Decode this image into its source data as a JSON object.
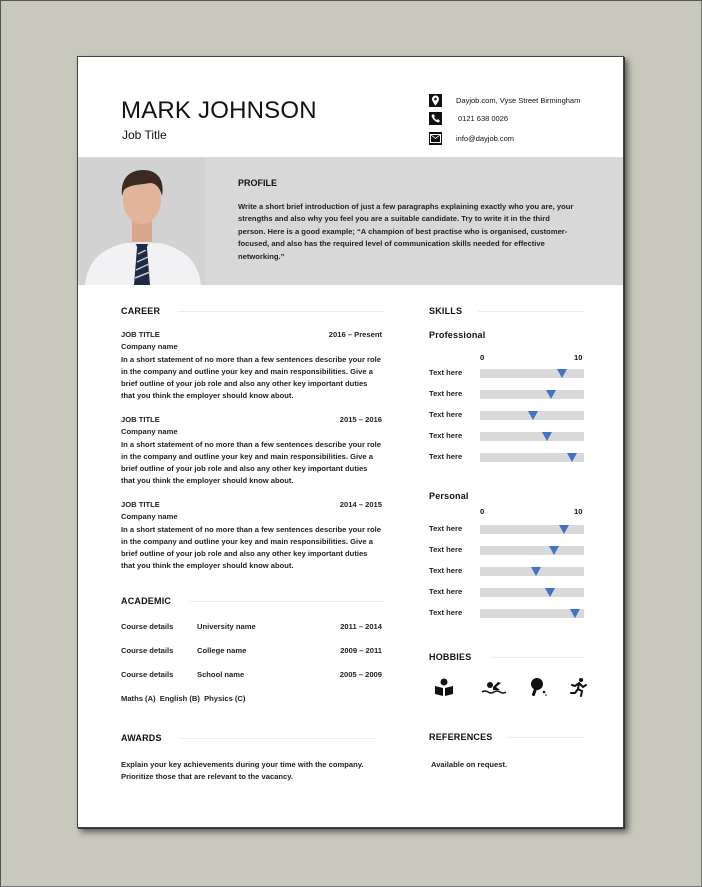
{
  "header": {
    "name": "MARK JOHNSON",
    "job_title": "Job Title",
    "contacts": [
      {
        "icon": "location-pin-icon",
        "text": "Dayjob.com, Vyse Street Birmingham"
      },
      {
        "icon": "phone-icon",
        "text": "0121 638 0026"
      },
      {
        "icon": "email-icon",
        "text": "info@dayjob.com"
      }
    ]
  },
  "profile": {
    "title": "PROFILE",
    "text": "Write a short brief introduction of just a few paragraphs explaining exactly who you are, your strengths and also why you feel you are a suitable candidate. Try to write it in the third person. Here is a good example; “A champion of best practise who is organised, customer-focused, and also has the required level of communication skills needed for effective networking.”"
  },
  "career": {
    "title": "CAREER",
    "jobs": [
      {
        "title": "JOB TITLE",
        "dates": "2016 – Present",
        "company": "Company name",
        "description": "In a short statement of no more than a few sentences describe your role in the company and outline your key and main responsibilities. Give a brief outline of your job role and also any other key important duties that you think the employer should know about."
      },
      {
        "title": "JOB TITLE",
        "dates": "2015 – 2016",
        "company": "Company name",
        "description": "In a short statement of no more than a few sentences describe your role in the company and outline your key and main responsibilities. Give a brief outline of your job role and also any other key important duties that you think the employer should know about."
      },
      {
        "title": "JOB TITLE",
        "dates": "2014 – 2015",
        "company": "Company name",
        "description": "In a short statement of no more than a few sentences describe your role in the company and outline your key and main responsibilities. Give a brief outline of your job role and also any other key important duties that you think the employer should know about."
      }
    ]
  },
  "academic": {
    "title": "ACADEMIC",
    "rows": [
      {
        "course": "Course details",
        "institution": "University name",
        "dates": "2011 – 2014"
      },
      {
        "course": "Course details",
        "institution": "College name",
        "dates": "2009 – 2011"
      },
      {
        "course": "Course details",
        "institution": "School name",
        "dates": "2005 – 2009"
      }
    ],
    "grades": "Maths (A)  English (B)  Physics (C)"
  },
  "awards": {
    "title": "AWARDS",
    "text": "Explain your key achievements during your time with the company. Prioritize those that are relevant to the vacancy."
  },
  "skills": {
    "title": "SKILLS",
    "scale_min": "0",
    "scale_max": "10",
    "accent_color": "#4472c4",
    "groups": [
      {
        "name": "Professional",
        "items": [
          {
            "label": "Text here",
            "value": 7.9
          },
          {
            "label": "Text here",
            "value": 6.8
          },
          {
            "label": "Text here",
            "value": 5.1
          },
          {
            "label": "Text here",
            "value": 6.4
          },
          {
            "label": "Text here",
            "value": 8.8
          }
        ]
      },
      {
        "name": "Personal",
        "items": [
          {
            "label": "Text here",
            "value": 8.1
          },
          {
            "label": "Text here",
            "value": 7.1
          },
          {
            "label": "Text here",
            "value": 5.4
          },
          {
            "label": "Text here",
            "value": 6.7
          },
          {
            "label": "Text here",
            "value": 9.1
          }
        ]
      }
    ]
  },
  "hobbies": {
    "title": "HOBBIES",
    "icons": [
      "reading-icon",
      "swimming-icon",
      "table-tennis-icon",
      "running-icon"
    ]
  },
  "references": {
    "title": "REFERENCES",
    "text": "Available on request."
  }
}
